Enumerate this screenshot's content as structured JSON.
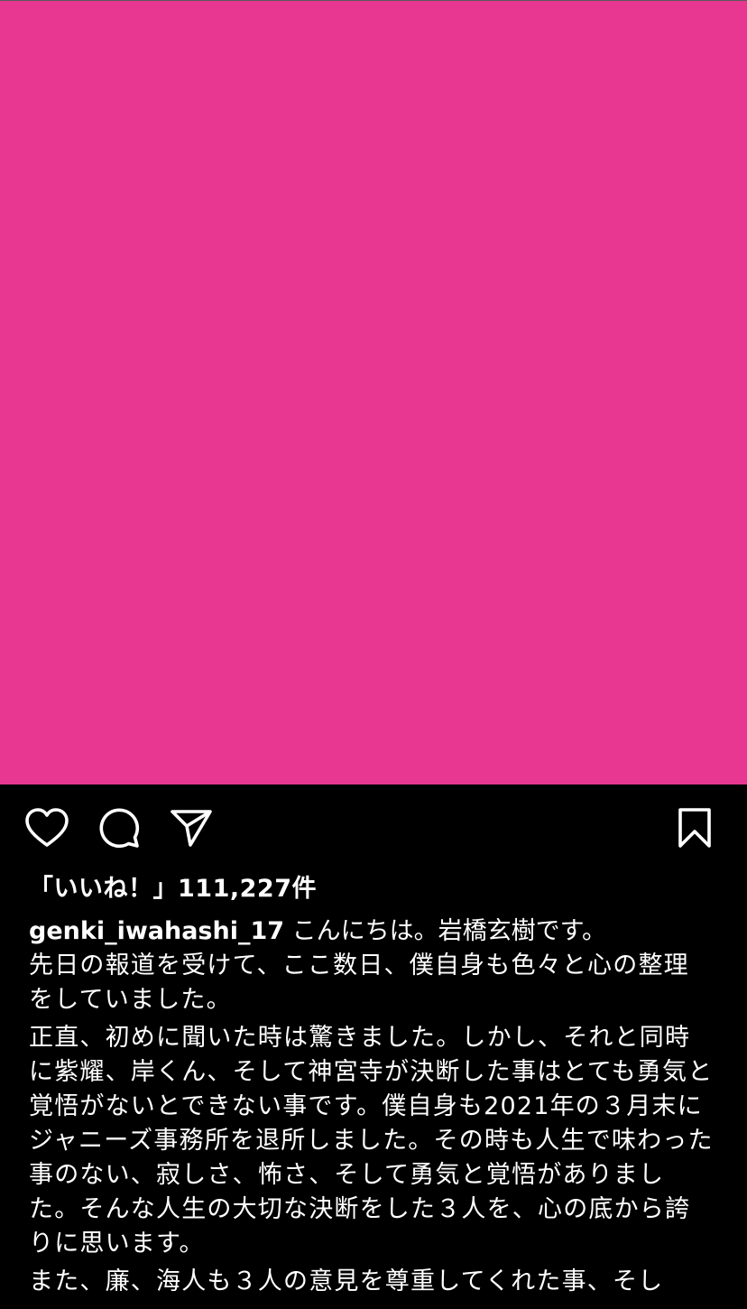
{
  "colors": {
    "post_image_bg": "#E83790",
    "background": "#000000",
    "text": "#FFFFFF"
  },
  "icons": {
    "like": "heart-outline",
    "comment": "speech-bubble-outline",
    "share": "paper-plane-outline",
    "save": "bookmark-outline"
  },
  "likes_text": "「いいね！」111,227件",
  "caption": {
    "username": "genki_iwahashi_17",
    "first_line": " こんにちは。岩橋玄樹です。",
    "paragraphs": [
      "先日の報道を受けて、ここ数日、僕自身も色々と心の整理をしていました。",
      "正直、初めに聞いた時は驚きました。しかし、それと同時に紫耀、岸くん、そして神宮寺が決断した事はとても勇気と覚悟がないとできない事です。僕自身も2021年の３月末にジャニーズ事務所を退所しました。その時も人生で味わった事のない、寂しさ、怖さ、そして勇気と覚悟がありました。そんな人生の大切な決断をした３人を、心の底から誇りに思います。",
      "また、廉、海人も３人の意見を尊重してくれた事、そし"
    ]
  }
}
